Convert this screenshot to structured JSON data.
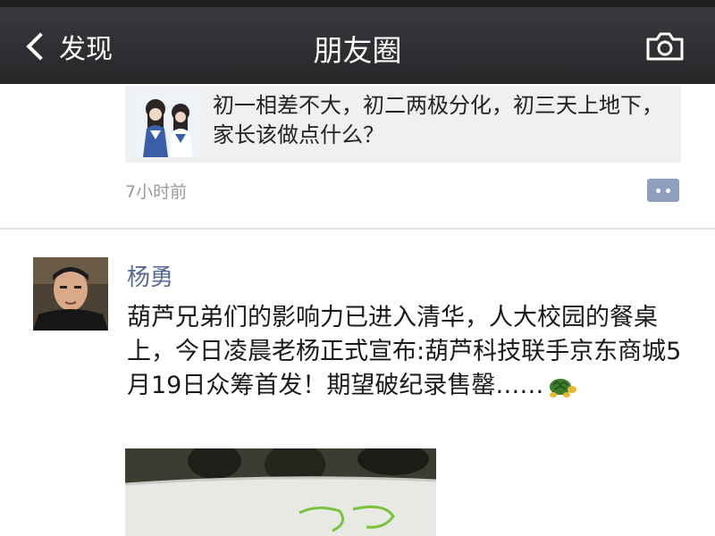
{
  "nav": {
    "back_label": "发现",
    "title": "朋友圈"
  },
  "post1": {
    "share_text": "初一相差不大，初二两极分化，初三天上地下，家长该做点什么？",
    "time": "7小时前"
  },
  "post2": {
    "author": "杨勇",
    "text": "葫芦兄弟们的影响力已进入清华，人大校园的餐桌上，今日凌晨老杨正式宣布:葫芦科技联手京东商城5月19日众筹首发！期望破纪录售罄……"
  },
  "colors": {
    "nav_bg": "#2d2e31",
    "link": "#576b95",
    "comment_btn": "#8e9fbf"
  },
  "icons": [
    "chevron-left-icon",
    "camera-icon",
    "comment-icon",
    "turtle-emoji-icon"
  ]
}
